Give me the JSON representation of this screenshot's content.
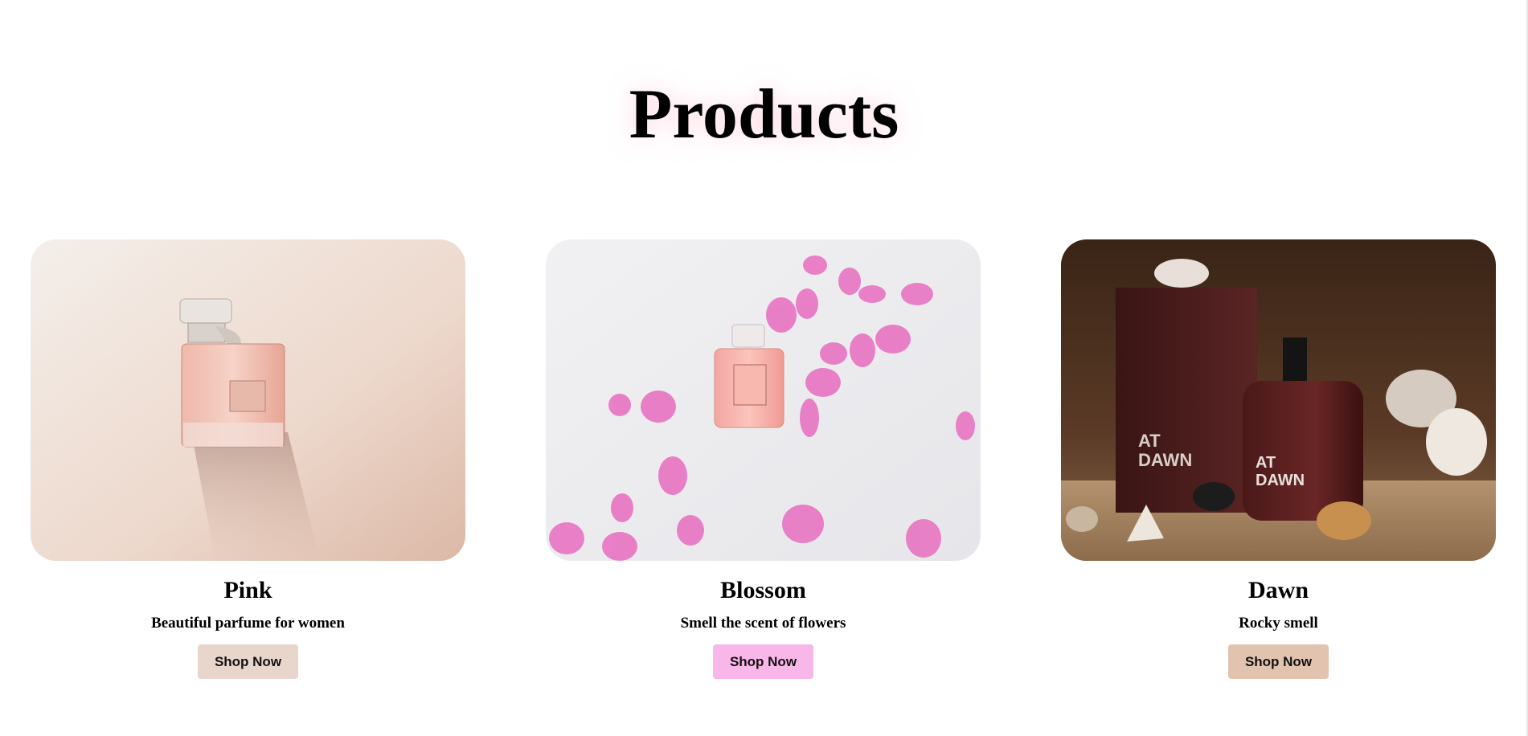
{
  "page": {
    "title": "Products"
  },
  "products": [
    {
      "name": "Pink",
      "description": "Beautiful parfume for women",
      "button_label": "Shop Now",
      "button_color": "#e8d6cc",
      "image": "pink-perfume-bottle"
    },
    {
      "name": "Blossom",
      "description": "Smell the scent of flowers",
      "button_label": "Shop Now",
      "button_color": "#f9b6e8",
      "image": "perfume-with-rose-petals"
    },
    {
      "name": "Dawn",
      "description": "Rocky smell",
      "button_label": "Shop Now",
      "button_color": "#e2c3b0",
      "image": "at-dawn-perfume-on-sand",
      "image_text": [
        "AT",
        "DAWN"
      ]
    }
  ]
}
